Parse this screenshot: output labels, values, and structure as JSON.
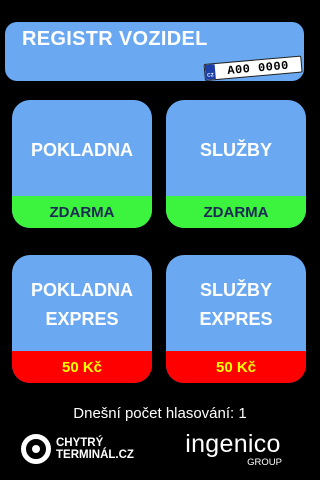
{
  "header": {
    "title": "REGISTR VOZIDEL",
    "plate": {
      "country": "CZ",
      "text": "A00 0000"
    }
  },
  "tiles": [
    {
      "label_lines": [
        "POKLADNA"
      ],
      "price": "ZDARMA",
      "color": "#3cf33e"
    },
    {
      "label_lines": [
        "SLUŽBY"
      ],
      "price": "ZDARMA",
      "color": "#3cf33e"
    },
    {
      "label_lines": [
        "POKLADNA",
        "EXPRES"
      ],
      "price": "50 Kč",
      "color": "#ff0000"
    },
    {
      "label_lines": [
        "SLUŽBY",
        "EXPRES"
      ],
      "price": "50 Kč",
      "color": "#ff0000"
    }
  ],
  "footer": {
    "vote_count": "Dnešní počet hlasování: 1",
    "logo_chytry": [
      "CHYTRÝ",
      "TERMINÁL.CZ"
    ],
    "logo_ingenico": {
      "main": "ingenico",
      "sub": "GROUP"
    }
  },
  "colors": {
    "tile": "#6aa9f2",
    "free": "#3cf33e",
    "paid": "#ff0000",
    "paid_text": "#ffff00"
  }
}
